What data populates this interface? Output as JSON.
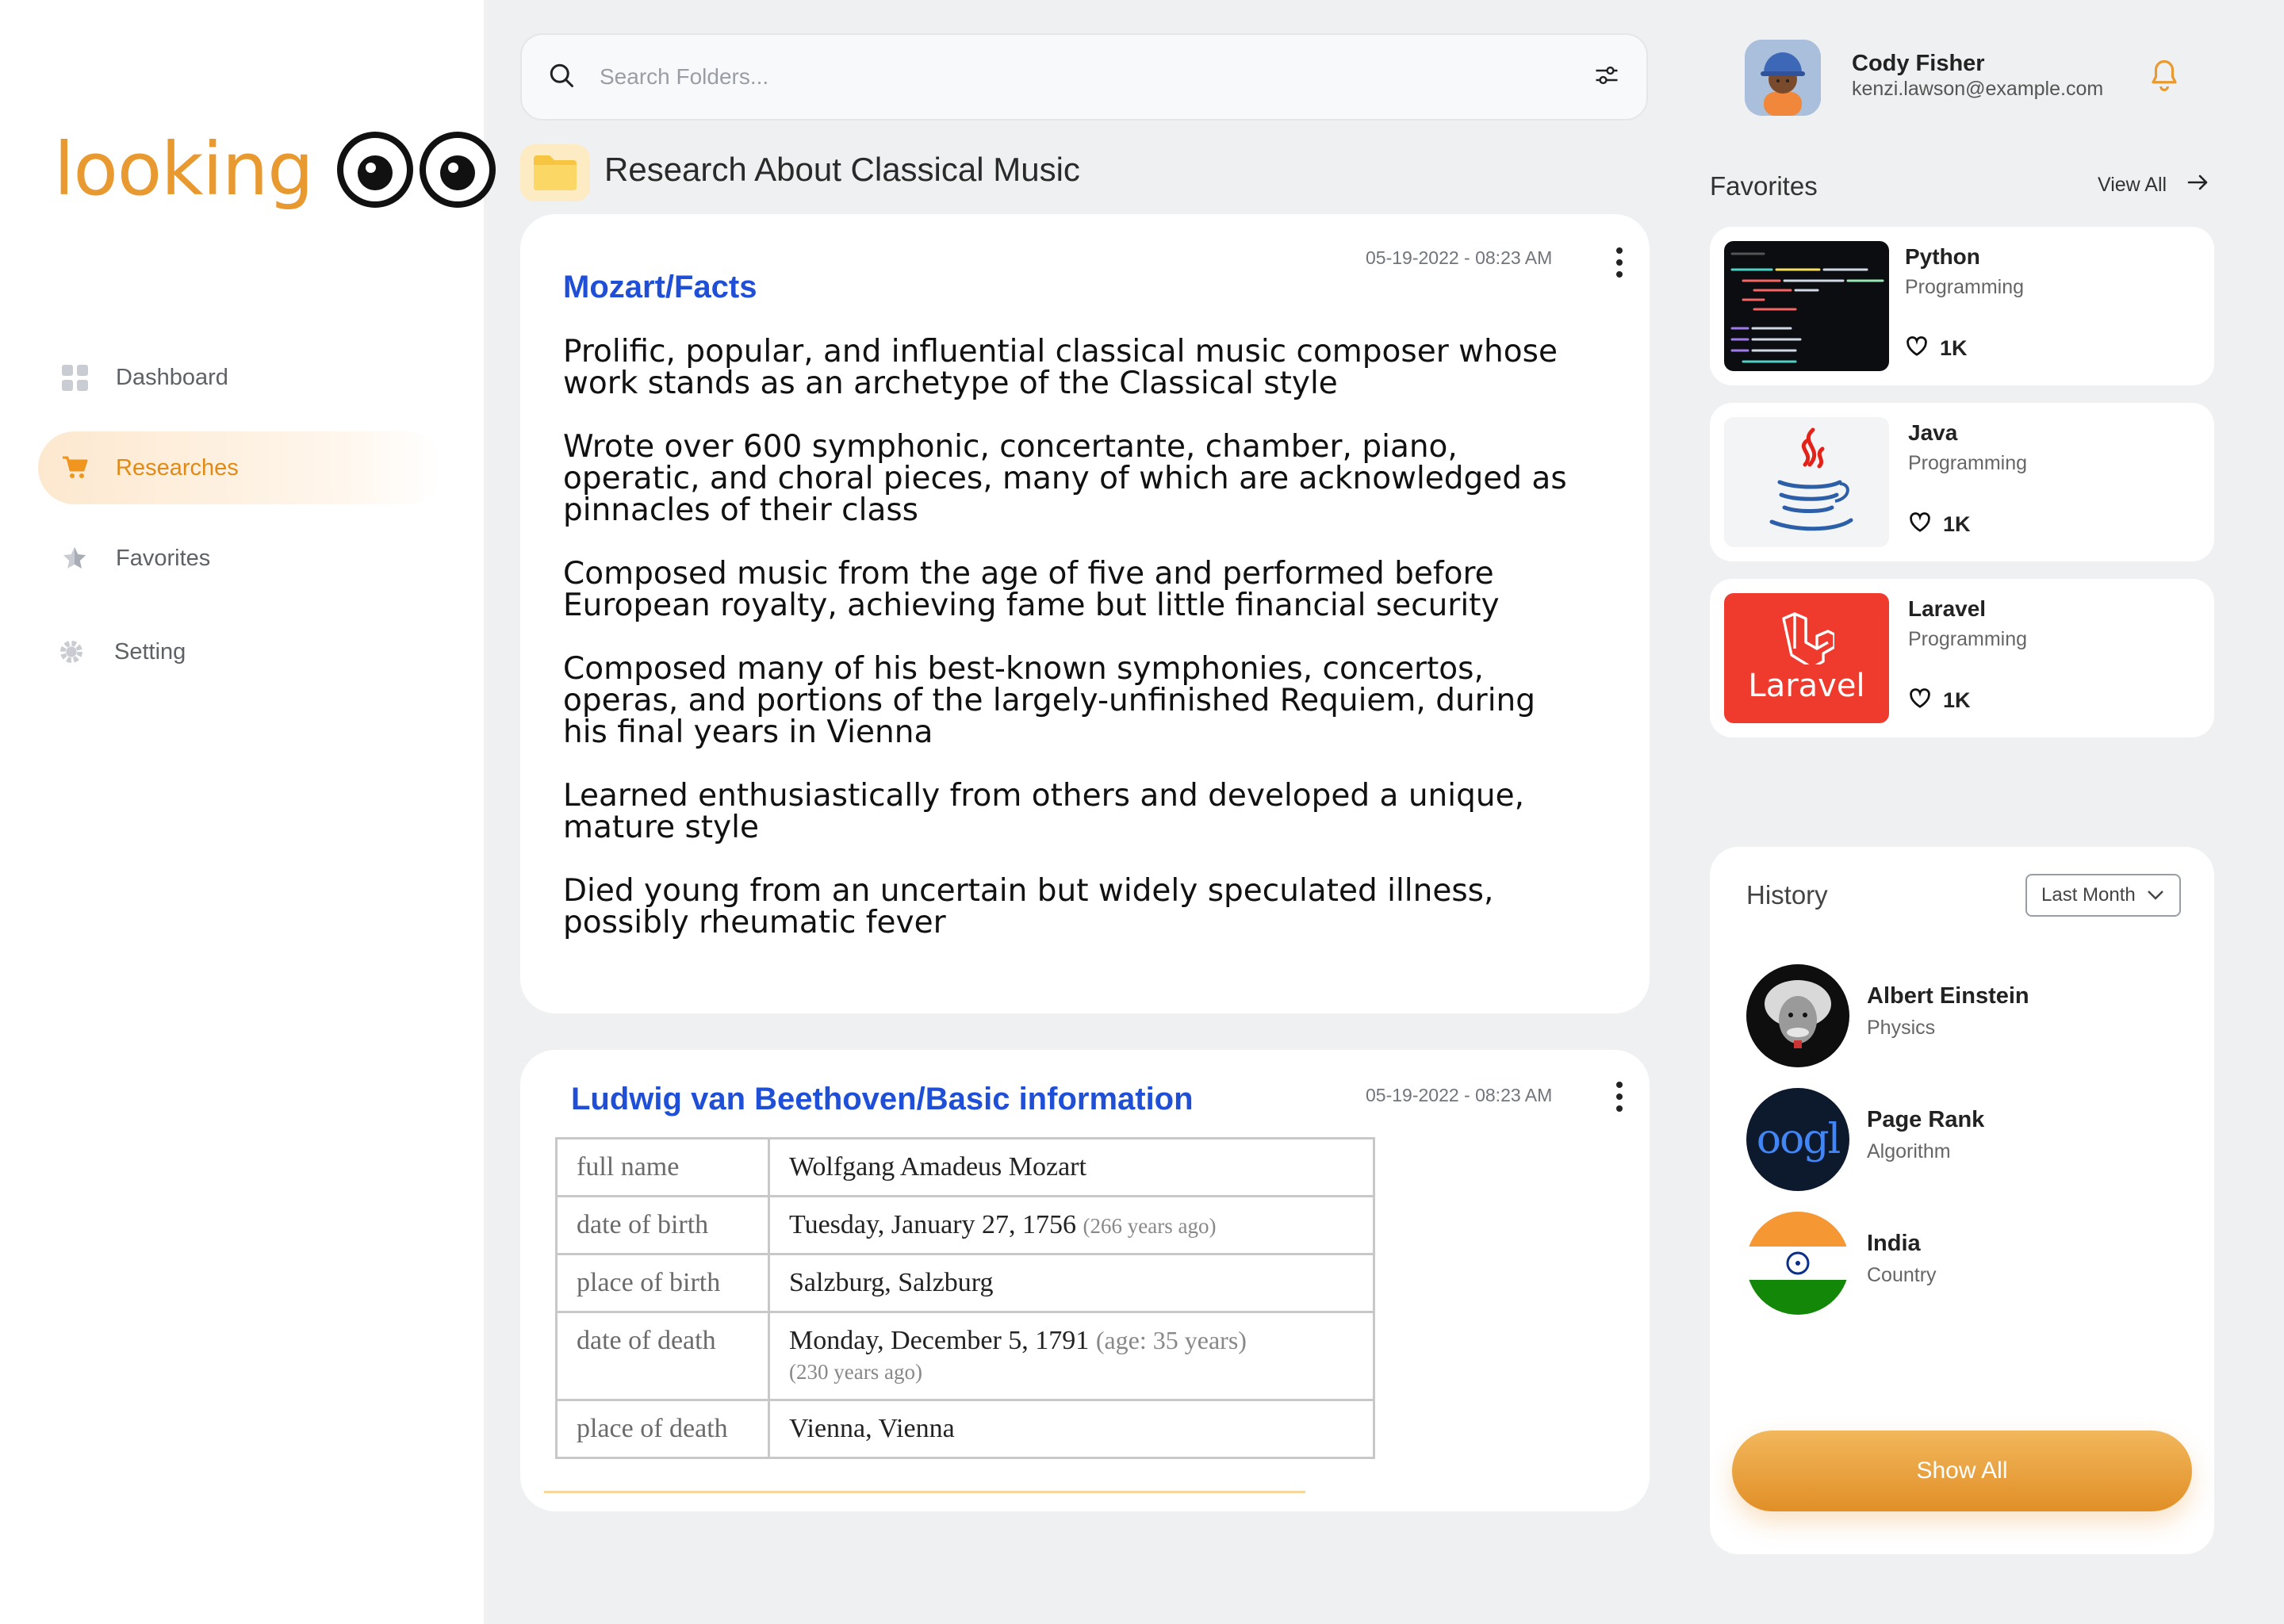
{
  "app": {
    "logo_text": "looking"
  },
  "sidebar": {
    "items": [
      {
        "label": "Dashboard",
        "icon": "grid-icon"
      },
      {
        "label": "Researches",
        "icon": "cart-icon",
        "active": true
      },
      {
        "label": "Favorites",
        "icon": "star-icon"
      },
      {
        "label": "Setting",
        "icon": "gear-icon"
      }
    ]
  },
  "search": {
    "placeholder": "Search Folders..."
  },
  "folder": {
    "title": "Research About Classical Music"
  },
  "cards": [
    {
      "title": "Mozart/Facts",
      "date": "05-19-2022 - 08:23 AM",
      "facts": [
        "Prolific, popular, and influential classical music composer whose work stands as an archetype of the Classical style",
        "Wrote over 600 symphonic, concertante, chamber, piano, operatic, and choral pieces, many of which are acknowledged as pinnacles of their class",
        "Composed music from the age of five and performed before European royalty, achieving fame but little financial security",
        "Composed many of his best-known symphonies, concertos, operas, and portions of the largely-unfinished Requiem, during his final years in Vienna",
        "Learned enthusiastically from others and developed a unique, mature style",
        "Died young from an uncertain but widely speculated illness, possibly rheumatic fever"
      ]
    },
    {
      "title": "Ludwig van Beethoven/Basic information",
      "date": "05-19-2022 - 08:23 AM",
      "table": [
        {
          "key": "full name",
          "value": "Wolfgang Amadeus Mozart",
          "note": "",
          "note2": ""
        },
        {
          "key": "date of birth",
          "value": "Tuesday, January 27, 1756",
          "note": "(266 years ago)",
          "note2": ""
        },
        {
          "key": "place of birth",
          "value": "Salzburg, Salzburg",
          "note": "",
          "note2": ""
        },
        {
          "key": "date of death",
          "value": "Monday, December 5, 1791",
          "note": "(age: 35 years)",
          "note2": "(230 years ago)"
        },
        {
          "key": "place of death",
          "value": "Vienna, Vienna",
          "note": "",
          "note2": ""
        }
      ]
    }
  ],
  "user": {
    "name": "Cody Fisher",
    "email": "kenzi.lawson@example.com"
  },
  "favorites": {
    "title": "Favorites",
    "view_all": "View All",
    "items": [
      {
        "name": "Python",
        "category": "Programming",
        "likes": "1K"
      },
      {
        "name": "Java",
        "category": "Programming",
        "likes": "1K"
      },
      {
        "name": "Laravel",
        "category": "Programming",
        "likes": "1K",
        "logo_text": "Laravel"
      }
    ]
  },
  "history": {
    "title": "History",
    "filter": "Last Month",
    "items": [
      {
        "name": "Albert Einstein",
        "category": "Physics"
      },
      {
        "name": "Page Rank",
        "category": "Algorithm",
        "image_text": "oogl"
      },
      {
        "name": "India",
        "category": "Country"
      }
    ],
    "show_all": "Show All"
  },
  "colors": {
    "accent": "#e89a30",
    "link": "#1e4fd6",
    "laravel": "#ef3b2d"
  }
}
